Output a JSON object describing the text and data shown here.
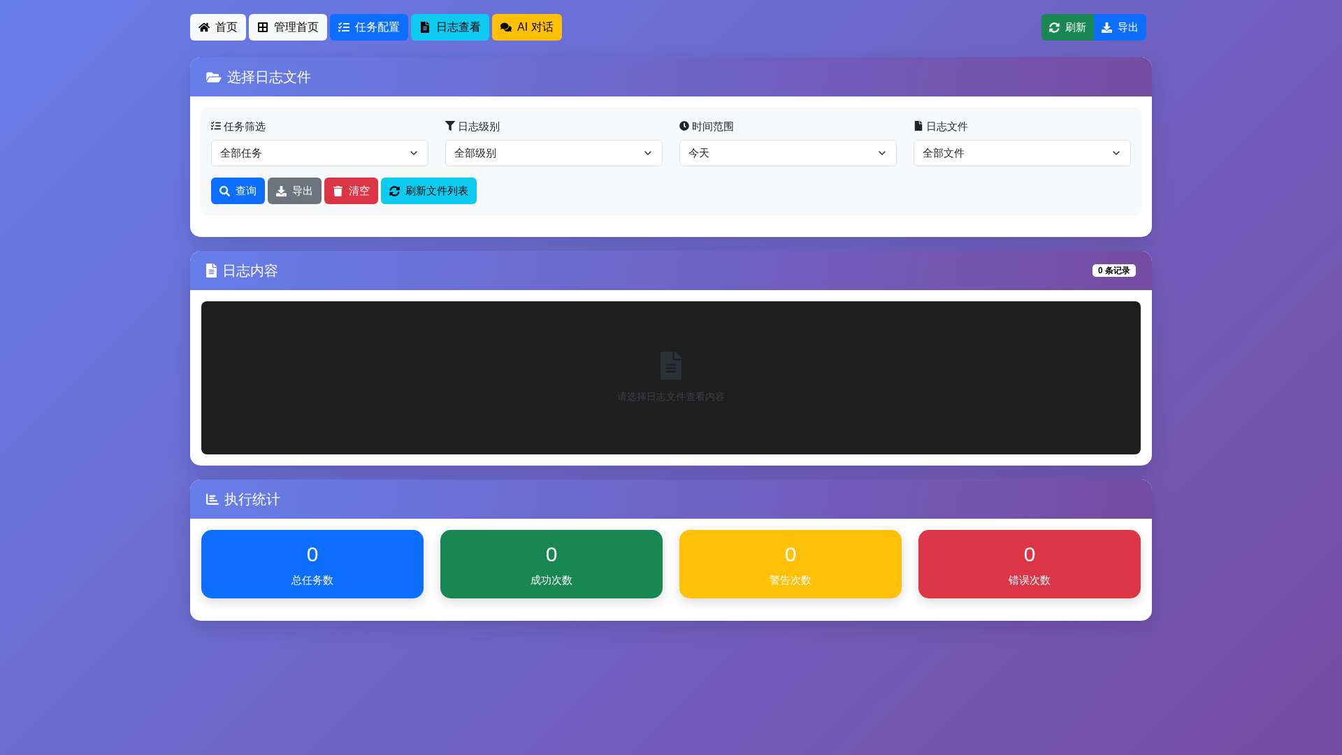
{
  "nav": {
    "links": [
      {
        "label": "首页",
        "color": "#f8f9fa"
      },
      {
        "label": "管理首页",
        "color": "#f8f9fa"
      },
      {
        "label": "任务配置",
        "color": "#0d6efd"
      },
      {
        "label": "日志查看",
        "color": "#0dcaf0"
      },
      {
        "label": "AI 对话",
        "color": "#ffc107"
      }
    ],
    "actions": [
      {
        "label": "刷新",
        "color": "#198754"
      },
      {
        "label": "导出",
        "color": "#0d6efd"
      }
    ]
  },
  "file_panel": {
    "title": "选择日志文件",
    "filters": [
      {
        "label": "任务筛选",
        "value": "全部任务"
      },
      {
        "label": "日志级别",
        "value": "全部级别"
      },
      {
        "label": "时间范围",
        "value": "今天"
      },
      {
        "label": "日志文件",
        "value": "全部文件"
      }
    ],
    "buttons": [
      {
        "label": "查询",
        "color": "#0d6efd"
      },
      {
        "label": "导出",
        "color": "#6c757d"
      },
      {
        "label": "清空",
        "color": "#dc3545"
      },
      {
        "label": "刷新文件列表",
        "color": "#0dcaf0"
      }
    ]
  },
  "log_panel": {
    "title": "日志内容",
    "badge": "0 条记录",
    "empty_message": "请选择日志文件查看内容"
  },
  "stats_panel": {
    "title": "执行统计",
    "cards": [
      {
        "value": "0",
        "label": "总任务数",
        "color": "#0d6efd"
      },
      {
        "value": "0",
        "label": "成功次数",
        "color": "#198754"
      },
      {
        "value": "0",
        "label": "警告次数",
        "color": "#ffc107"
      },
      {
        "value": "0",
        "label": "错误次数",
        "color": "#dc3545"
      }
    ]
  }
}
